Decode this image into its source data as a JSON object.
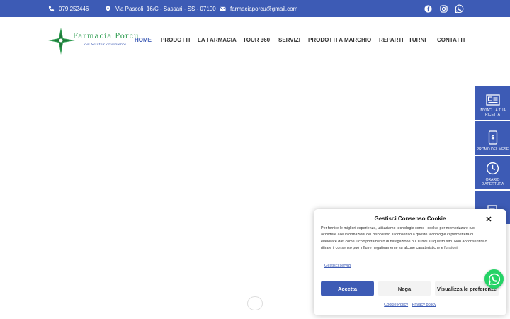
{
  "topbar": {
    "phone": "079 252446",
    "address": "Via Pascoli, 16/C - Sassari - SS - 07100",
    "email": "farmaciaporcu@gmail.com"
  },
  "logo": {
    "name": "Farmacia Porcu",
    "tagline": "dei Salute Conveniente"
  },
  "nav": {
    "items": [
      "HOME",
      "PRODOTTI",
      "LA FARMACIA",
      "TOUR 360",
      "SERVIZI",
      "PRODOTTI A MARCHIO",
      "REPARTI",
      "TURNI",
      "CONTATTI"
    ],
    "active": "HOME"
  },
  "sidetabs": [
    {
      "label": "INVIACI LA TUA RICETTA",
      "icon": "prescription-icon"
    },
    {
      "label": "PROMO DEL MESE",
      "icon": "phone-dollar-icon"
    },
    {
      "label": "ORARIO D'APERTURA",
      "icon": "clock-icon"
    },
    {
      "label": "",
      "icon": "notepad-icon"
    }
  ],
  "cookie": {
    "title": "Gestisci Consenso Cookie",
    "text": "Per fornire le migliori esperienze, utilizziamo tecnologie come i cookie per memorizzare e/o accedere alle informazioni del dispositivo. Il consenso a queste tecnologie ci permetterà di elaborare dati come il comportamento di navigazione o ID unici su questo sito. Non acconsentire o ritirare il consenso può influire negativamente su alcune caratteristiche e funzioni.",
    "manage_link": "Gestisci servizi",
    "accept": "Accetta",
    "deny": "Nega",
    "preferences": "Visualizza le preferenze",
    "cookie_policy": "Cookie Policy",
    "privacy_policy": "Privacy policy"
  },
  "colors": {
    "brand_blue": "#3d5bb5",
    "brand_green": "#2d9c4f",
    "whatsapp": "#25d366"
  }
}
